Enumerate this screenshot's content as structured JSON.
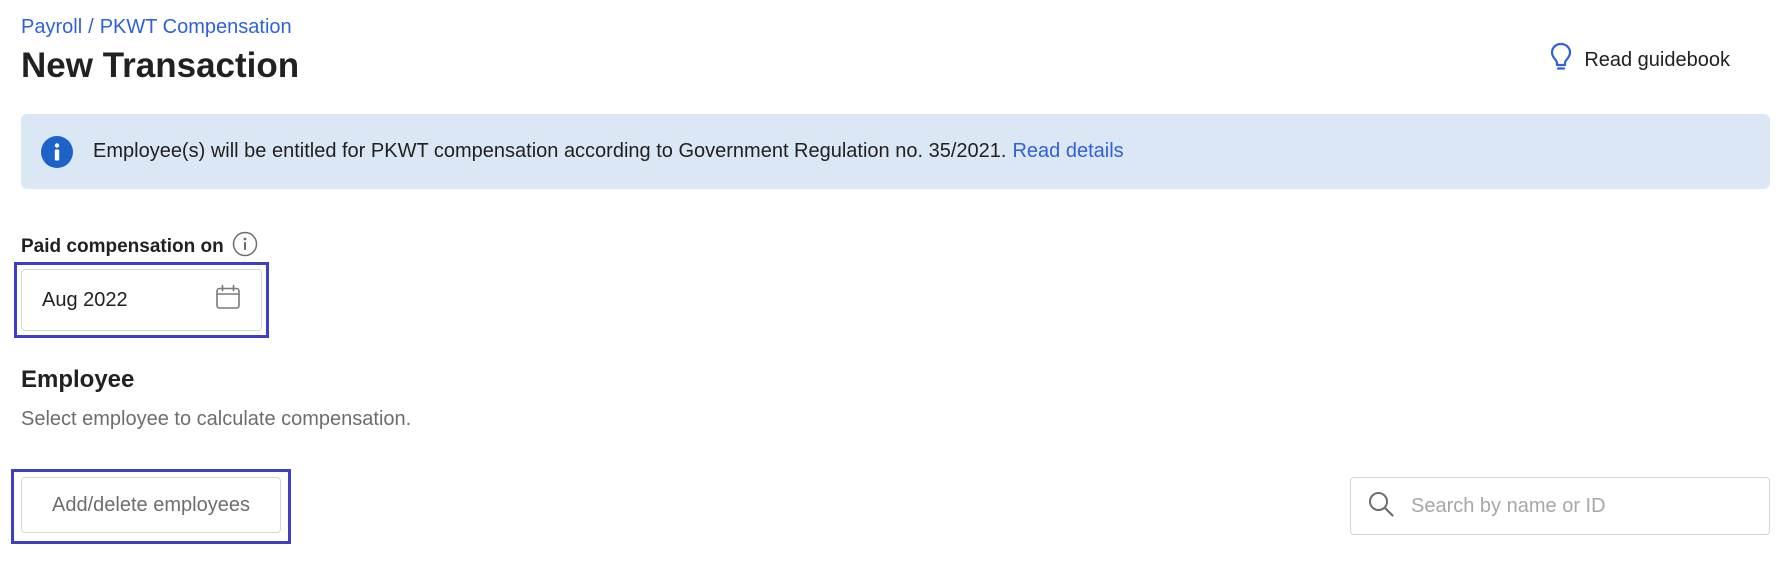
{
  "breadcrumb": {
    "items": [
      "Payroll",
      "PKWT Compensation"
    ],
    "separator": "/"
  },
  "header": {
    "title": "New Transaction",
    "guidebook_label": "Read guidebook",
    "guidebook_icon": "lightbulb-icon"
  },
  "banner": {
    "icon": "info-icon",
    "message": "Employee(s) will be entitled for PKWT compensation according to Government Regulation no. 35/2021.",
    "link_label": "Read details",
    "background": "#dbe7f4"
  },
  "payment": {
    "label": "Paid compensation on",
    "label_icon": "info-outline-icon",
    "value": "Aug 2022",
    "value_icon": "calendar-icon"
  },
  "employee": {
    "title": "Employee",
    "subtitle": "Select employee to calculate compensation.",
    "add_button_label": "Add/delete employees",
    "search_placeholder": "Search by name or ID",
    "search_icon": "search-icon"
  },
  "colors": {
    "link": "#2f62d8",
    "focus_ring": "#3f3fc4",
    "info": "#1c62c7"
  }
}
